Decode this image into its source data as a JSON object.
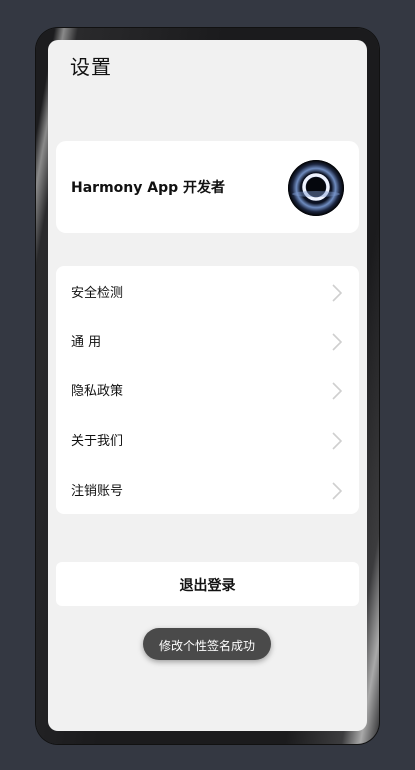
{
  "page": {
    "title": "设置"
  },
  "profile": {
    "name": "Harmony App 开发者",
    "avatar_icon": "eclipse-ring-avatar"
  },
  "menu": {
    "items": [
      {
        "label": "安全检测",
        "icon": "chevron-right-icon"
      },
      {
        "label": "通 用",
        "icon": "chevron-right-icon"
      },
      {
        "label": "隐私政策",
        "icon": "chevron-right-icon"
      },
      {
        "label": "关于我们",
        "icon": "chevron-right-icon"
      },
      {
        "label": "注销账号",
        "icon": "chevron-right-icon"
      }
    ]
  },
  "logout": {
    "label": "退出登录"
  },
  "toast": {
    "message": "修改个性签名成功"
  },
  "colors": {
    "background": "#343842",
    "screen": "#f1f1f1",
    "card": "#ffffff",
    "toast": "#4a4a4a",
    "chevron": "#cfcfcf"
  }
}
